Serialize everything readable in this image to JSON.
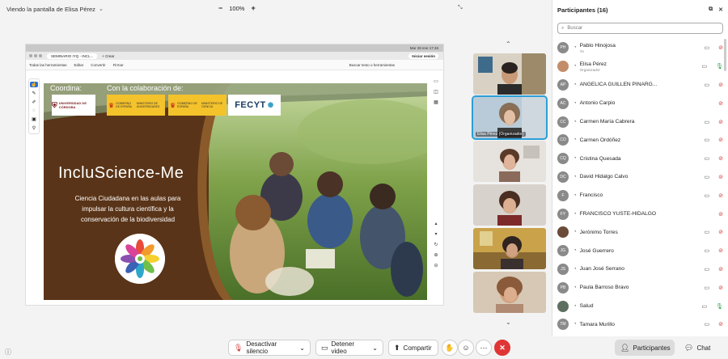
{
  "topbar": {
    "viewing_label": "Viendo la pantalla de Elisa Pérez",
    "zoom_minus": "−",
    "zoom_level": "100%",
    "zoom_plus": "+"
  },
  "shared_screen": {
    "mac_clock": "Mar 28 ene 17:46",
    "browser_tab": "SEMINARIO IYQ - INCL...",
    "new_tab": "+ Crear",
    "sign_in": "Iniciar sesión",
    "acrobat_menu": [
      "Todas las herramientas",
      "Editar",
      "Convertir",
      "Firmar"
    ],
    "acrobat_search": "Buscar texto o herramientas"
  },
  "slide": {
    "coordina": "Coordina:",
    "colaboracion": "Con la colaboración de:",
    "uco_logo_text": "UNIVERSIDAD DE CÓRDOBA",
    "gob_logo_1": "GOBIERNO DE ESPAÑA",
    "gob_logo_1b": "MINISTERIO DE UNIVERSIDADES",
    "gob_logo_2": "GOBIERNO DE ESPAÑA",
    "gob_logo_2b": "MINISTERIO DE CIENCIA",
    "fecyt": "FECYT",
    "title": "IncluScience-Me",
    "subtitle": "Ciencia Ciudadana en las aulas para impulsar la cultura científica y la conservación de la biodiversidad"
  },
  "video_tiles": [
    {
      "name": ""
    },
    {
      "name": "Elisa Pérez (Organizador)"
    },
    {
      "name": ""
    },
    {
      "name": ""
    },
    {
      "name": ""
    },
    {
      "name": ""
    }
  ],
  "panel": {
    "title": "Participantes (16)",
    "search_placeholder": "Buscar",
    "participants": [
      {
        "initials": "PH",
        "name": "Pablo Hinojosa",
        "sub": "Yo",
        "mute": "red"
      },
      {
        "initials": "",
        "name": "Elisa Pérez",
        "sub": "Organizador",
        "mute": "green"
      },
      {
        "initials": "AP",
        "name": "ANGELICA GUILLEN PINARG...",
        "sub": "",
        "mute": "red"
      },
      {
        "initials": "AC",
        "name": "Antonio Carpio",
        "sub": "",
        "mute": "red"
      },
      {
        "initials": "CC",
        "name": "Carmen María Cabrera",
        "sub": "",
        "mute": "red"
      },
      {
        "initials": "CO",
        "name": "Carmen Ordóñez",
        "sub": "",
        "mute": "red"
      },
      {
        "initials": "CQ",
        "name": "Cristina Quesada",
        "sub": "",
        "mute": "red"
      },
      {
        "initials": "DC",
        "name": "David Hidalgo Calvo",
        "sub": "",
        "mute": "red"
      },
      {
        "initials": "F",
        "name": "Francisco",
        "sub": "",
        "mute": "red"
      },
      {
        "initials": "FY",
        "name": "FRANCISCO YUSTE-HIDALGO",
        "sub": "",
        "mute": "red"
      },
      {
        "initials": "",
        "name": "Jerónimo Torres",
        "sub": "",
        "mute": "red"
      },
      {
        "initials": "JG",
        "name": "José Guerrero",
        "sub": "",
        "mute": "red"
      },
      {
        "initials": "JS",
        "name": "Juan José Serrano",
        "sub": "",
        "mute": "red"
      },
      {
        "initials": "PB",
        "name": "Paula Barroso Bravo",
        "sub": "",
        "mute": "red"
      },
      {
        "initials": "",
        "name": "Salud",
        "sub": "",
        "mute": "green"
      },
      {
        "initials": "TM",
        "name": "Tamara Murillo",
        "sub": "",
        "mute": "red"
      }
    ]
  },
  "bottombar": {
    "unmute": "Desactivar silencio",
    "stop_video": "Detener video",
    "share": "Compartir",
    "participants": "Participantes",
    "chat": "Chat"
  }
}
